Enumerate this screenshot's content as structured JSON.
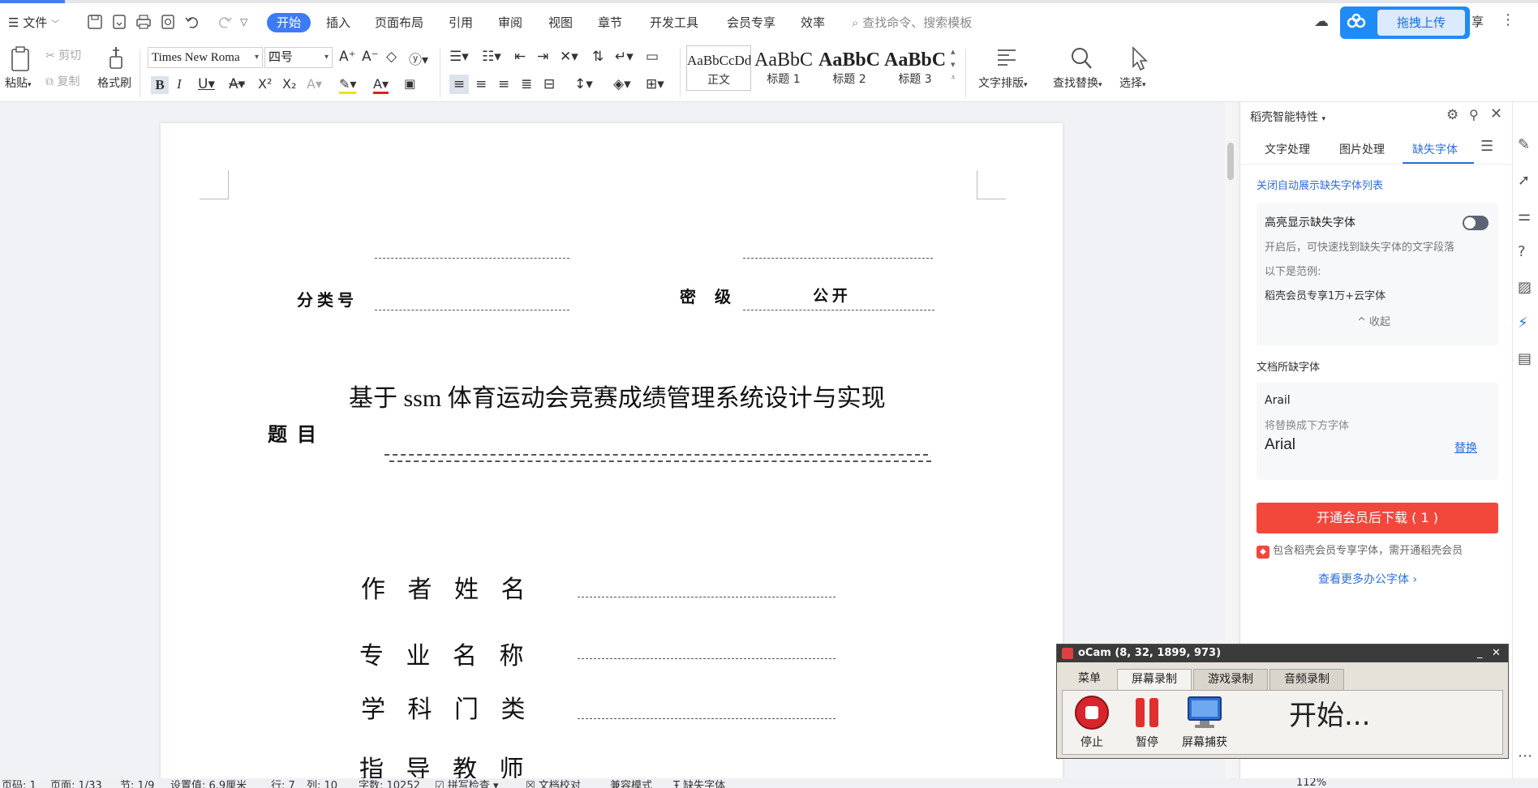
{
  "menubar": {
    "file": "文件",
    "tabs": [
      "开始",
      "插入",
      "页面布局",
      "引用",
      "审阅",
      "视图",
      "章节",
      "开发工具",
      "会员专享",
      "效率"
    ],
    "search_placeholder": "查找命令、搜索模板",
    "upload": "拖拽上传",
    "share": "享"
  },
  "ribbon": {
    "paste": "粘贴",
    "cut": "剪切",
    "copy": "复制",
    "format_painter": "格式刷",
    "font_name": "Times New Roma",
    "font_size": "四号",
    "styles": [
      {
        "sample": "AaBbCcDd",
        "name": "正文"
      },
      {
        "sample": "AaBbC",
        "name": "标题 1"
      },
      {
        "sample": "AaBbC",
        "name": "标题 2"
      },
      {
        "sample": "AaBbC",
        "name": "标题 3"
      }
    ],
    "text_layout": "文字排版",
    "find_replace": "查找替换",
    "select": "选择"
  },
  "document": {
    "classification_label": "分 类 号",
    "secret_label": "密 级",
    "secret_value": "公 开",
    "title": "基于 ssm 体育运动会竞赛成绩管理系统设计与实现",
    "title_label": "题 目",
    "fields": [
      "作 者 姓 名",
      "专 业 名 称",
      "学 科 门 类",
      "指 导 教 师"
    ]
  },
  "panel": {
    "header": "稻壳智能特性",
    "tabs": [
      "文字处理",
      "图片处理",
      "缺失字体"
    ],
    "active_tab": "缺失字体",
    "close_auto_list": "关闭自动展示缺失字体列表",
    "highlight_title": "高亮显示缺失字体",
    "highlight_desc": "开启后，可快速找到缺失字体的文字段落",
    "example_label": "以下是范例:",
    "example_text": "稻壳会员专享1万+云字体",
    "collapse": "收起",
    "missing_section": "文档所缺字体",
    "missing_font": "Arail",
    "replace_hint": "将替换成下方字体",
    "replacement_font": "Arial",
    "replace_link": "替换",
    "download_btn": "开通会员后下载 ( 1 )",
    "member_note": "包含稻壳会员专享字体，需开通稻壳会员",
    "more_fonts": "查看更多办公字体"
  },
  "ocam": {
    "title": "oCam (8, 32, 1899, 973)",
    "tabs": [
      "菜单",
      "屏幕录制",
      "游戏录制",
      "音频录制"
    ],
    "stop": "停止",
    "pause": "暂停",
    "capture": "屏幕捕获",
    "status": "开始..."
  },
  "statusbar": {
    "items": [
      "页码: 1",
      "页面: 1/33",
      "节: 1/9",
      "设置值: 6.9厘米",
      "行: 7",
      "列: 10",
      "字数: 10252",
      "拼写检查",
      "文档校对",
      "兼容模式",
      "缺失字体"
    ],
    "zoom": "112%"
  },
  "colors": {
    "accent": "#3d7bf6",
    "download_btn": "#f2483b",
    "link": "#2f6ee0"
  }
}
